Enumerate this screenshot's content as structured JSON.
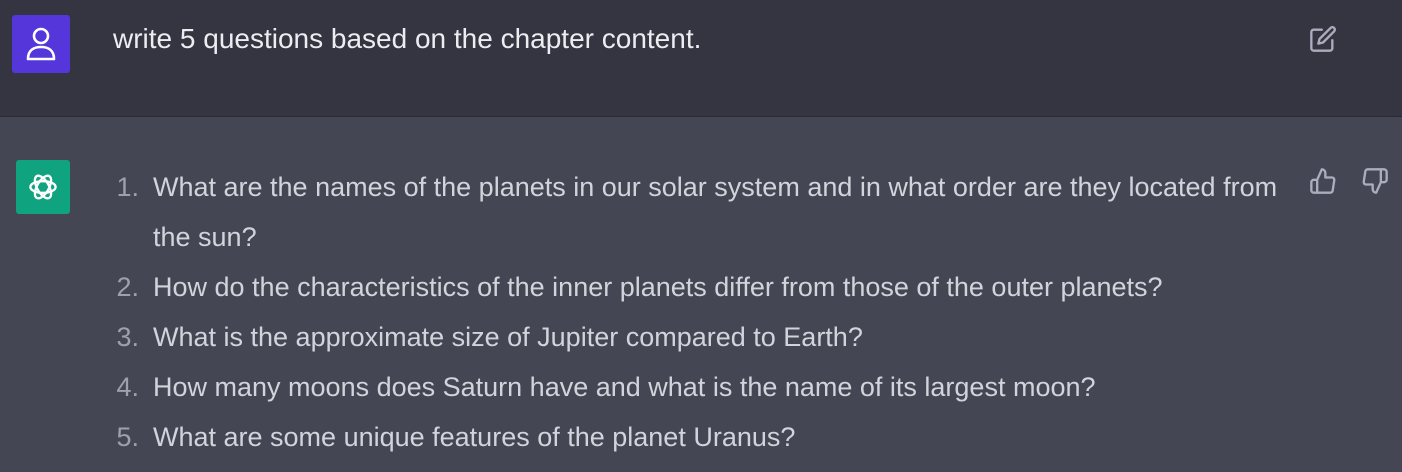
{
  "conversation": {
    "user_message": {
      "avatar_icon": "user-icon",
      "avatar_color": "#5436da",
      "text": "write 5 questions based on the chapter content.",
      "edit_icon": "edit-icon"
    },
    "assistant_message": {
      "avatar_icon": "openai-logo-icon",
      "avatar_color": "#10a37f",
      "items": [
        {
          "num": "1.",
          "text": "What are the names of the planets in our solar system and in what order are they located from the sun?"
        },
        {
          "num": "2.",
          "text": "How do the characteristics of the inner planets differ from those of the outer planets?"
        },
        {
          "num": "3.",
          "text": "What is the approximate size of Jupiter compared to Earth?"
        },
        {
          "num": "4.",
          "text": "How many moons does Saturn have and what is the name of its largest moon?"
        },
        {
          "num": "5.",
          "text": "What are some unique features of the planet Uranus?"
        }
      ],
      "feedback_icons": [
        "thumbs-up-icon",
        "thumbs-down-icon"
      ]
    }
  },
  "colors": {
    "user_row_bg": "#343541",
    "assistant_row_bg": "#444654",
    "text": "#ececf1",
    "muted": "#9ea1ab"
  }
}
